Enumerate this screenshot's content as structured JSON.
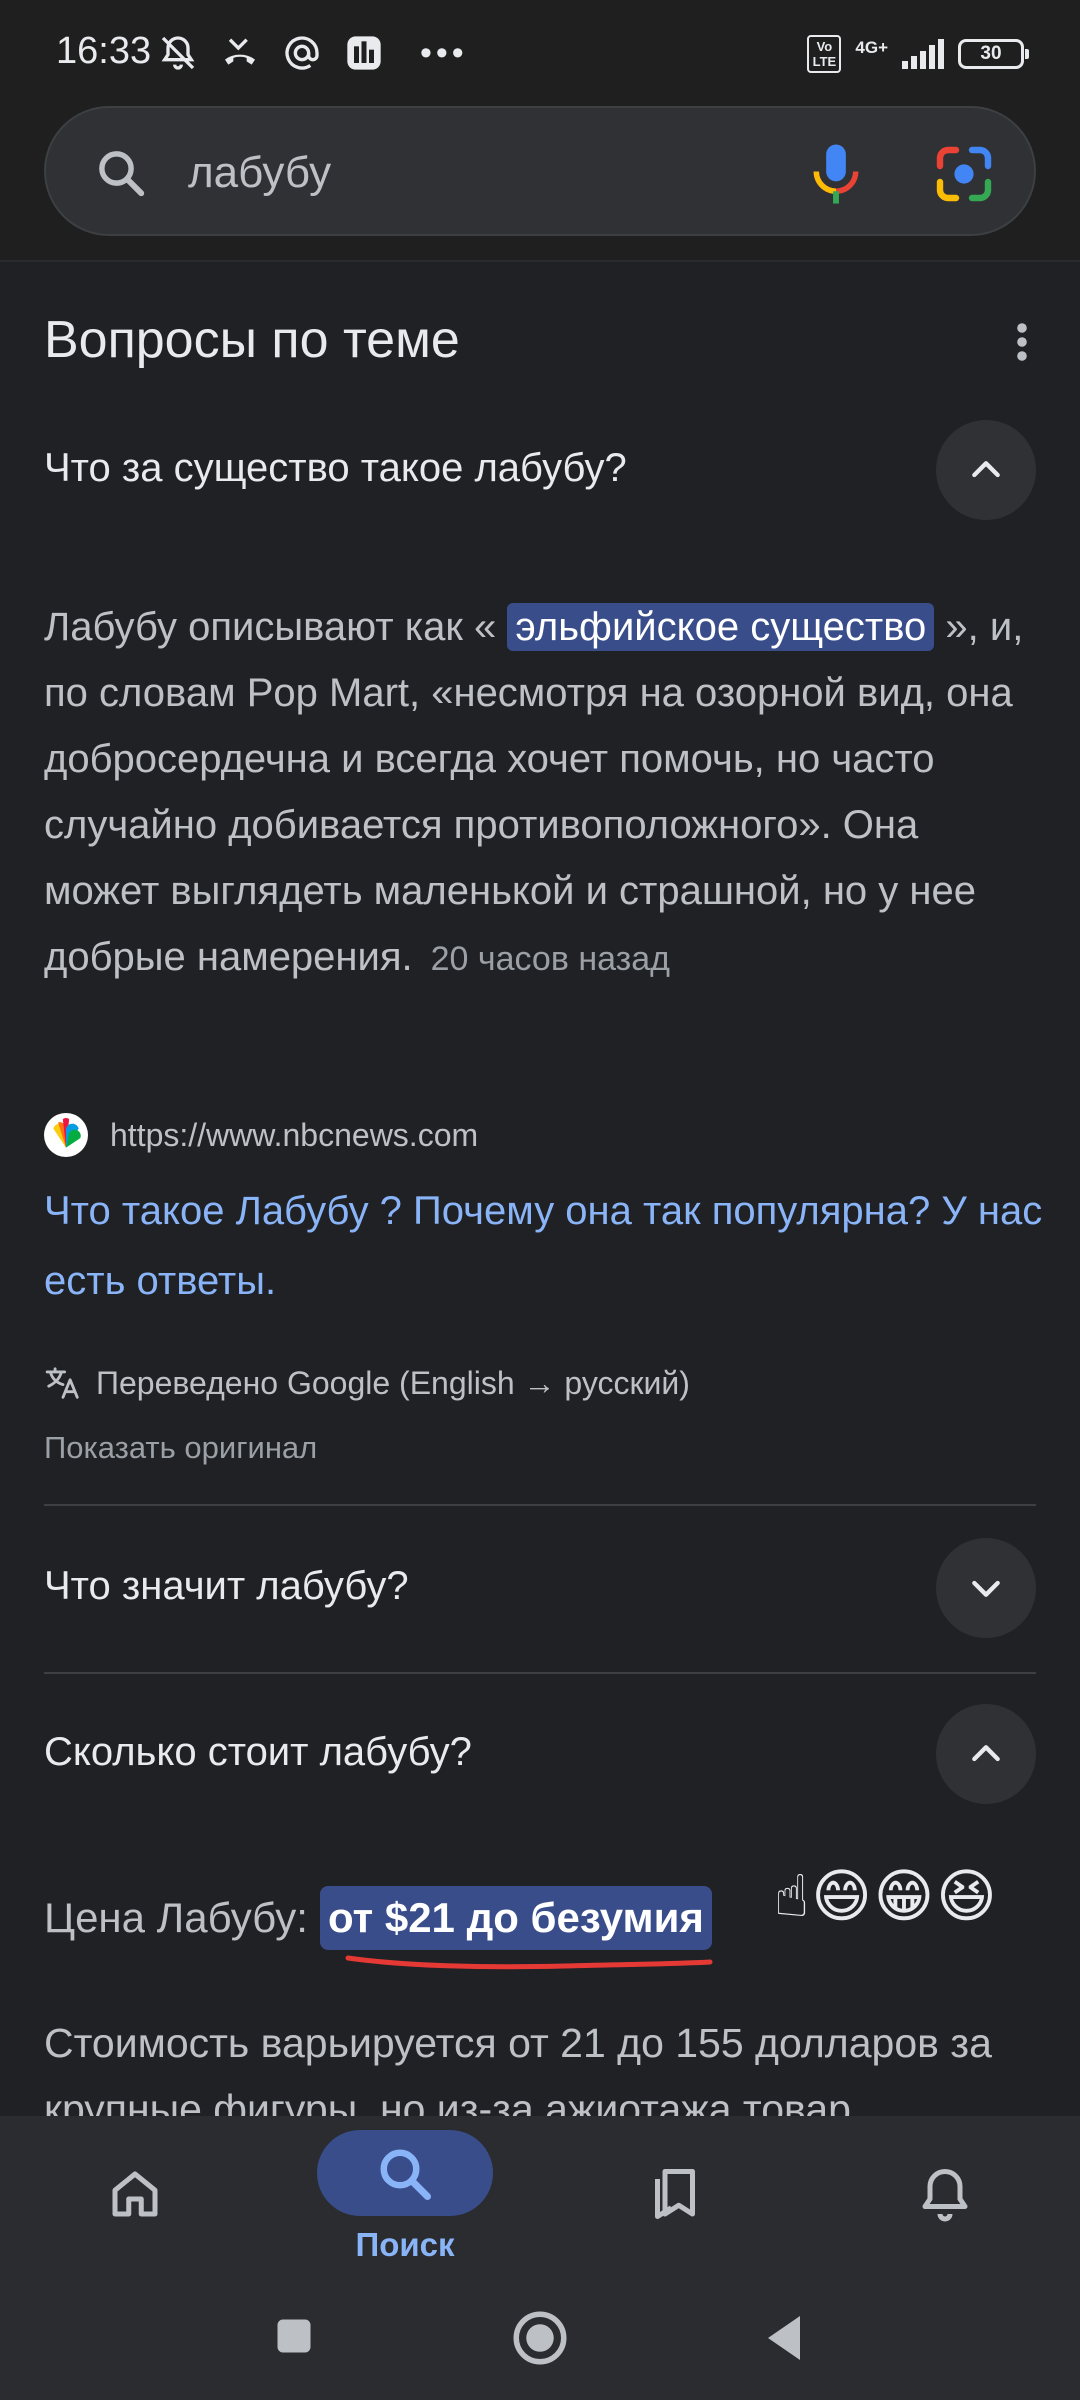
{
  "status_bar": {
    "time": "16:33",
    "network": "4G+",
    "volte": "Vo LTE",
    "battery": "30"
  },
  "search": {
    "query": "лабубу",
    "icons": [
      "search-icon",
      "mic-icon",
      "lens-icon"
    ]
  },
  "related_questions": {
    "title": "Вопросы по теме",
    "items": [
      {
        "question": "Что за существо такое лабубу?",
        "expanded": true,
        "answer_before": "Лабубу описывают как « ",
        "answer_highlight": "эльфийское существо",
        "answer_after": " », и, по словам Pop Mart, «несмотря на озорной вид, она добросердечна и всегда хочет помочь, но часто случайно добивается противоположного». Она может выглядеть маленькой и страшной, но у нее добрые намерения.",
        "answer_age": "20 часов назад",
        "source_url": "https://www.nbcnews.com",
        "result_title": "Что такое Лабубу ? Почему она так популярна? У нас есть ответы.",
        "translation_note": "Переведено Google (English → русский)",
        "show_original": "Показать оригинал"
      },
      {
        "question": "Что значит лабубу?",
        "expanded": false
      },
      {
        "question": "Сколько стоит лабубу?",
        "expanded": true,
        "price_label": "Цена Лабубу:",
        "price_highlight": "от $21 до безумия",
        "emojis": "☝😄😁😆",
        "description": "Стоимость варьируется от 21 до 155 долларов за крупные фигуры, но из-за ажиотажа товар"
      }
    ]
  },
  "bottom_nav": {
    "items": [
      {
        "icon": "home-icon",
        "label": ""
      },
      {
        "icon": "search-icon",
        "label": "Поиск",
        "active": true
      },
      {
        "icon": "collections-icon",
        "label": ""
      },
      {
        "icon": "notifications-icon",
        "label": ""
      }
    ]
  },
  "colors": {
    "background": "#202124",
    "highlight": "#394d8a",
    "link": "#8ab4f8",
    "underline_annotation": "#e53935"
  }
}
